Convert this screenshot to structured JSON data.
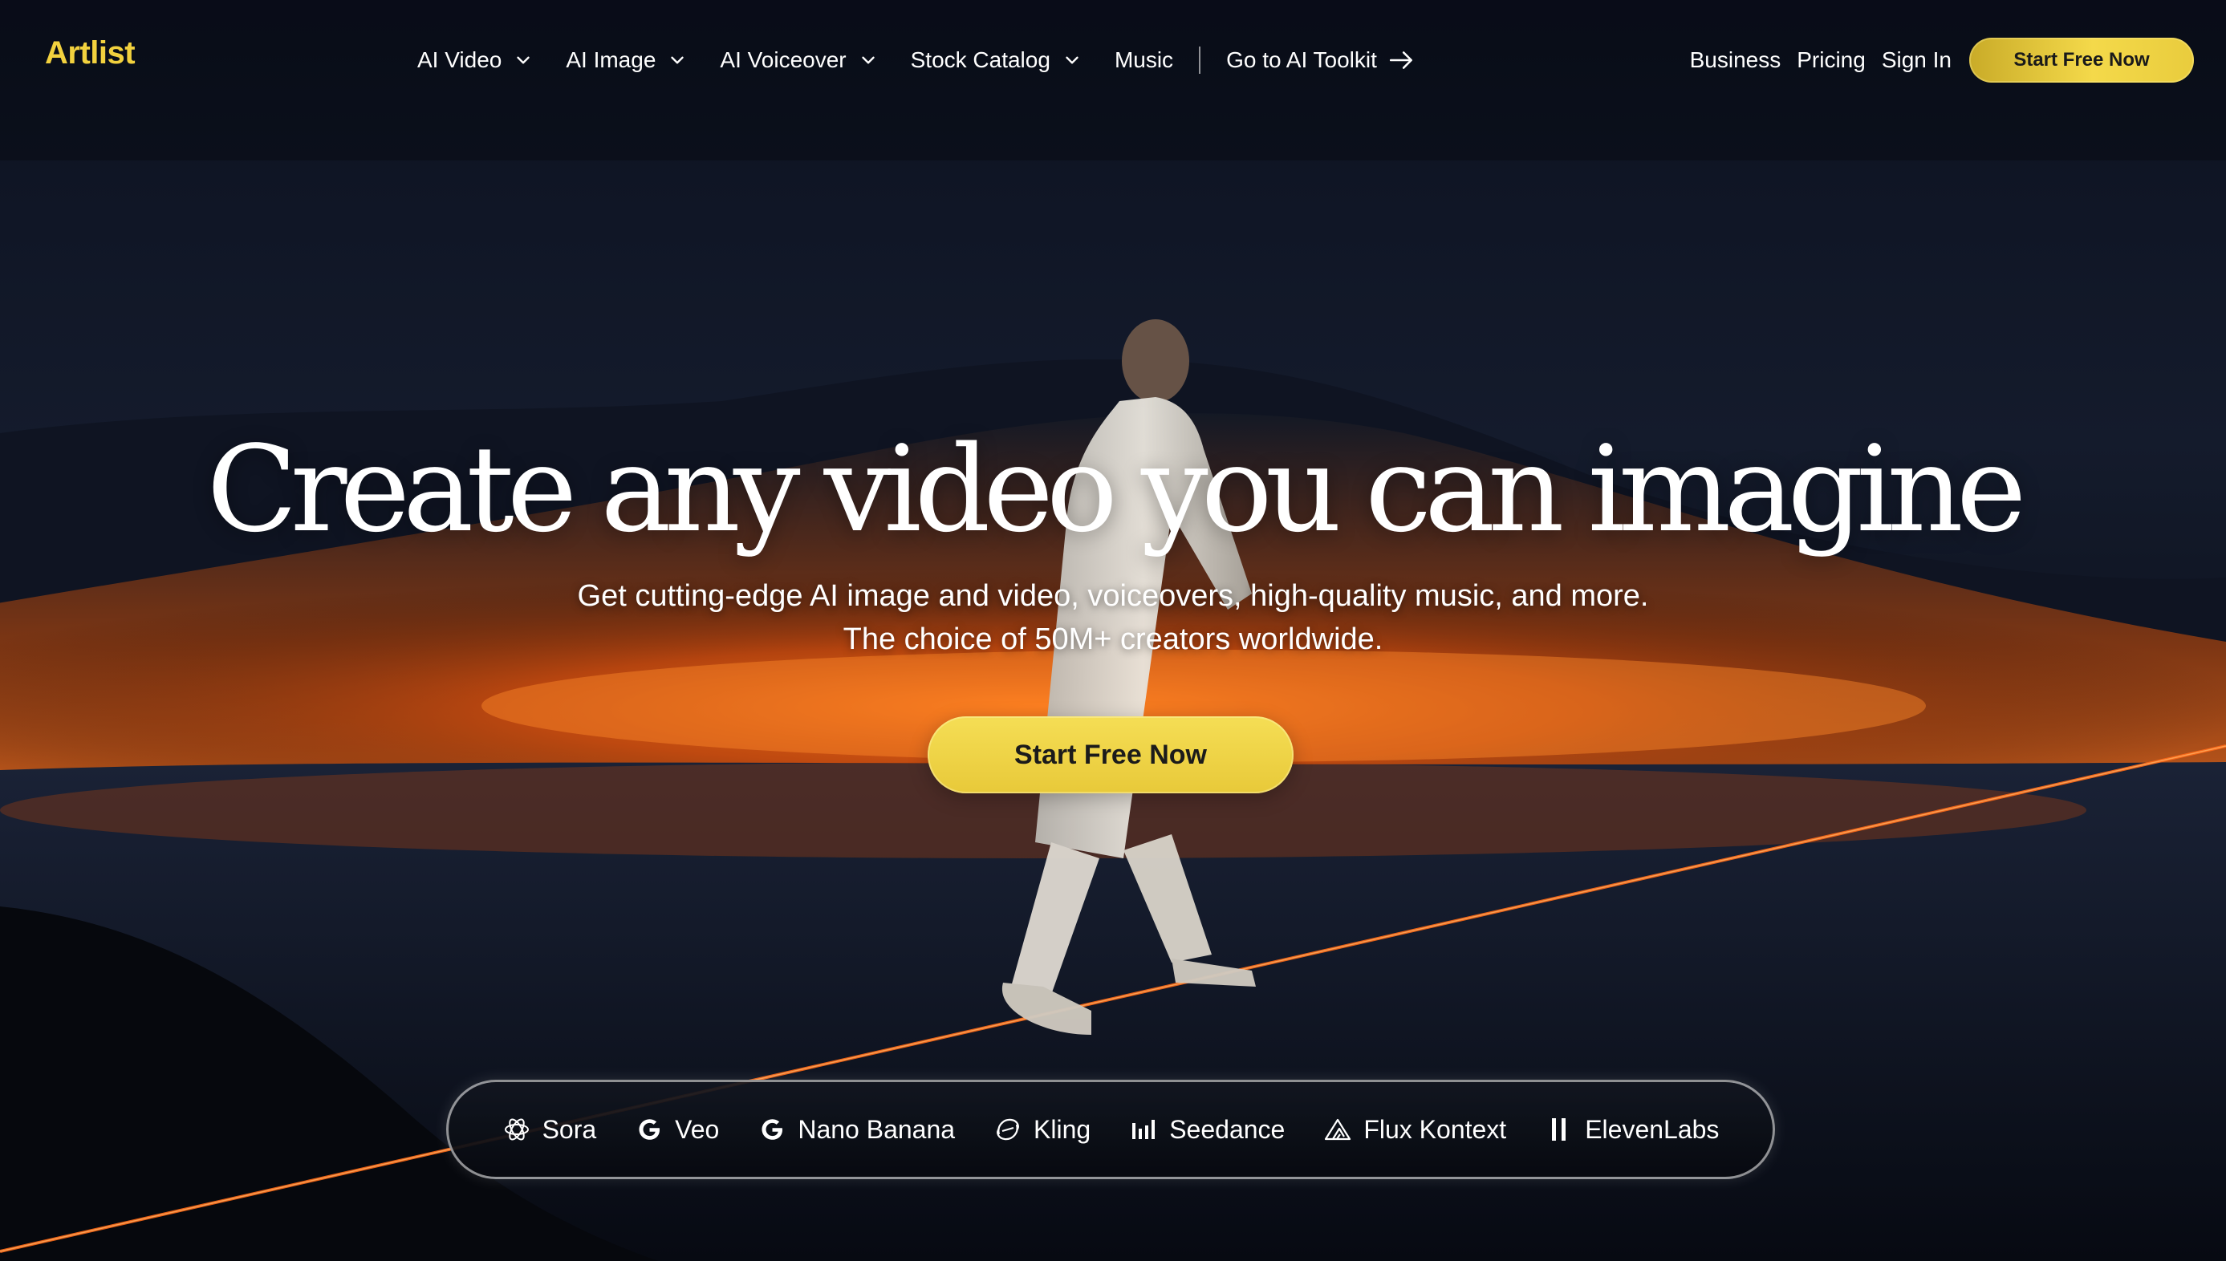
{
  "brand": {
    "logo": "Artlist",
    "accent": "#f2d13e"
  },
  "nav": {
    "items": [
      {
        "label": "AI Video",
        "icon": "chevron-down-icon"
      },
      {
        "label": "AI Image",
        "icon": "chevron-down-icon"
      },
      {
        "label": "AI Voiceover",
        "icon": "chevron-down-icon"
      },
      {
        "label": "Stock Catalog",
        "icon": "chevron-down-icon"
      },
      {
        "label": "Music"
      }
    ],
    "toolkit_label": "Go to AI Toolkit",
    "toolkit_icon": "arrow-right-icon",
    "right": {
      "business": "Business",
      "pricing": "Pricing",
      "sign_in": "Sign In",
      "cta": "Start Free Now"
    }
  },
  "hero": {
    "title": "Create any video you can imagine",
    "subtitle_line1": "Get cutting-edge AI image and video, voiceovers, high-quality music, and more.",
    "subtitle_line2": "The choice of 50M+ creators worldwide.",
    "cta": "Start Free Now"
  },
  "models": [
    {
      "label": "Sora",
      "icon": "openai-icon"
    },
    {
      "label": "Veo",
      "icon": "google-g-icon"
    },
    {
      "label": "Nano Banana",
      "icon": "google-g-icon"
    },
    {
      "label": "Kling",
      "icon": "kling-icon"
    },
    {
      "label": "Seedance",
      "icon": "seedance-bars-icon"
    },
    {
      "label": "Flux Kontext",
      "icon": "flux-triangle-icon"
    },
    {
      "label": "ElevenLabs",
      "icon": "elevenlabs-icon"
    }
  ]
}
